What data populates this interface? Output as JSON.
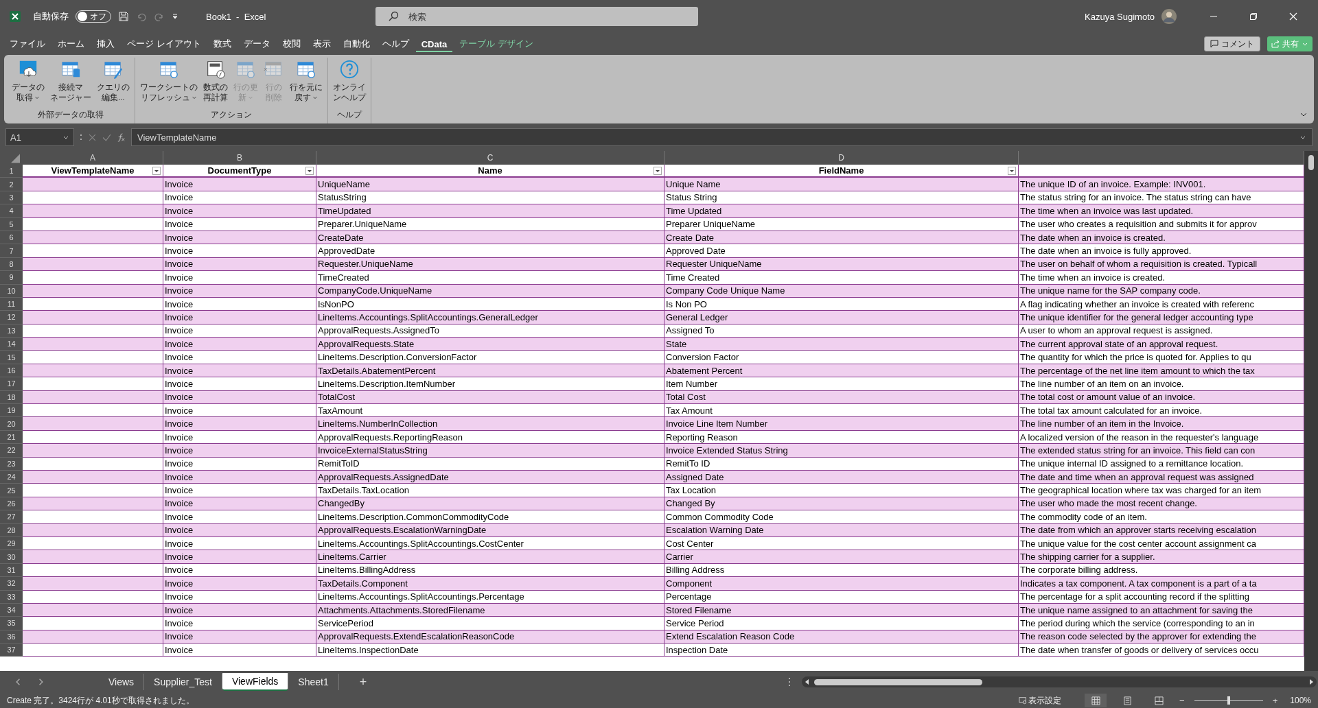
{
  "title_bar": {
    "autosave_label": "自動保存",
    "autosave": {
      "on": false,
      "label": "オフ"
    },
    "quick_access": [
      {
        "kind": "save",
        "disabled": false
      },
      {
        "kind": "undo",
        "disabled": true
      },
      {
        "kind": "redo",
        "disabled": true
      },
      {
        "kind": "customize",
        "disabled": false
      }
    ],
    "title": "Book1  -  Excel",
    "search": {
      "placeholder": "検索"
    },
    "user": "Kazuya Sugimoto"
  },
  "menu_tabs": [
    {
      "label": "ファイル",
      "selected": false,
      "kind": "normal"
    },
    {
      "label": "ホーム",
      "selected": false,
      "kind": "normal"
    },
    {
      "label": "挿入",
      "selected": false,
      "kind": "normal"
    },
    {
      "label": "ページ レイアウト",
      "selected": false,
      "kind": "normal"
    },
    {
      "label": "数式",
      "selected": false,
      "kind": "normal"
    },
    {
      "label": "データ",
      "selected": false,
      "kind": "normal"
    },
    {
      "label": "校閲",
      "selected": false,
      "kind": "normal"
    },
    {
      "label": "表示",
      "selected": false,
      "kind": "normal"
    },
    {
      "label": "自動化",
      "selected": false,
      "kind": "normal"
    },
    {
      "label": "ヘルプ",
      "selected": false,
      "kind": "normal"
    },
    {
      "label": "CData",
      "selected": true,
      "kind": "normal"
    },
    {
      "label": "テーブル デザイン",
      "selected": false,
      "kind": "contextual"
    }
  ],
  "header_buttons": {
    "comment": "コメント",
    "share": "共有"
  },
  "ribbon": [
    {
      "label": "外部データの取得",
      "buttons": [
        {
          "kind": "cloud",
          "lines": [
            "データの",
            "取得"
          ],
          "dropdown": true,
          "disabled": false
        },
        {
          "kind": "database",
          "lines": [
            "接続マ",
            "ネージャー"
          ],
          "dropdown": false,
          "disabled": false
        },
        {
          "kind": "edit",
          "lines": [
            "クエリの",
            "編集..."
          ],
          "dropdown": false,
          "disabled": false
        }
      ]
    },
    {
      "label": "アクション",
      "buttons": [
        {
          "kind": "refresh",
          "lines": [
            "ワークシートの",
            "リフレッシュ"
          ],
          "dropdown": true,
          "disabled": false
        },
        {
          "kind": "formula",
          "lines": [
            "数式の",
            "再計算"
          ],
          "dropdown": false,
          "disabled": false
        },
        {
          "kind": "update",
          "lines": [
            "行の更",
            "新"
          ],
          "dropdown": true,
          "disabled": true
        },
        {
          "kind": "delete",
          "lines": [
            "行の",
            "削除"
          ],
          "dropdown": false,
          "disabled": true
        },
        {
          "kind": "revert",
          "lines": [
            "行を元に",
            "戻す"
          ],
          "dropdown": true,
          "disabled": false
        }
      ]
    },
    {
      "label": "ヘルプ",
      "buttons": [
        {
          "kind": "help",
          "lines": [
            "オンライ",
            "ンヘルプ"
          ],
          "dropdown": false,
          "disabled": false
        }
      ]
    }
  ],
  "formula_bar": {
    "name_box": "A1",
    "value": "ViewTemplateName"
  },
  "column_headers": [
    "A",
    "B",
    "C",
    "D"
  ],
  "header_row": {
    "row": "1",
    "cells": [
      "ViewTemplateName",
      "DocumentType",
      "Name",
      "FieldName"
    ]
  },
  "rows": [
    {
      "row": "2",
      "document_type": "Invoice",
      "name": "UniqueName",
      "field_name": "Unique Name",
      "column_e": "The unique ID of an invoice. Example: INV001."
    },
    {
      "row": "3",
      "document_type": "Invoice",
      "name": "StatusString",
      "field_name": "Status String",
      "column_e": "The status string for an invoice. The status string can have"
    },
    {
      "row": "4",
      "document_type": "Invoice",
      "name": "TimeUpdated",
      "field_name": "Time Updated",
      "column_e": "The time when an invoice was last updated."
    },
    {
      "row": "5",
      "document_type": "Invoice",
      "name": "Preparer.UniqueName",
      "field_name": "Preparer UniqueName",
      "column_e": "The user who creates a requisition and submits it for approv"
    },
    {
      "row": "6",
      "document_type": "Invoice",
      "name": "CreateDate",
      "field_name": "Create Date",
      "column_e": "The date when an invoice is created."
    },
    {
      "row": "7",
      "document_type": "Invoice",
      "name": "ApprovedDate",
      "field_name": "Approved Date",
      "column_e": "The date when an invoice is fully approved."
    },
    {
      "row": "8",
      "document_type": "Invoice",
      "name": "Requester.UniqueName",
      "field_name": "Requester UniqueName",
      "column_e": "The user on behalf of whom a requisition is created. Typicall"
    },
    {
      "row": "9",
      "document_type": "Invoice",
      "name": "TimeCreated",
      "field_name": "Time Created",
      "column_e": "The time when an invoice is created."
    },
    {
      "row": "10",
      "document_type": "Invoice",
      "name": "CompanyCode.UniqueName",
      "field_name": "Company Code Unique Name",
      "column_e": "The unique name for the SAP company code."
    },
    {
      "row": "11",
      "document_type": "Invoice",
      "name": "IsNonPO",
      "field_name": "Is Non PO",
      "column_e": "A flag indicating whether an invoice is created with referenc"
    },
    {
      "row": "12",
      "document_type": "Invoice",
      "name": "LineItems.Accountings.SplitAccountings.GeneralLedger",
      "field_name": "General Ledger",
      "column_e": "The unique identifier for the general ledger accounting type"
    },
    {
      "row": "13",
      "document_type": "Invoice",
      "name": "ApprovalRequests.AssignedTo",
      "field_name": "Assigned To",
      "column_e": "A user to whom an approval request is assigned."
    },
    {
      "row": "14",
      "document_type": "Invoice",
      "name": "ApprovalRequests.State",
      "field_name": "State",
      "column_e": "The current approval state of an approval request."
    },
    {
      "row": "15",
      "document_type": "Invoice",
      "name": "LineItems.Description.ConversionFactor",
      "field_name": "Conversion Factor",
      "column_e": "The quantity for which the price is quoted for. Applies to qu"
    },
    {
      "row": "16",
      "document_type": "Invoice",
      "name": "TaxDetails.AbatementPercent",
      "field_name": "Abatement Percent",
      "column_e": "The percentage of the net line item amount to which the tax"
    },
    {
      "row": "17",
      "document_type": "Invoice",
      "name": "LineItems.Description.ItemNumber",
      "field_name": "Item Number",
      "column_e": "The line number of an item on an invoice."
    },
    {
      "row": "18",
      "document_type": "Invoice",
      "name": "TotalCost",
      "field_name": "Total Cost",
      "column_e": "The total cost or amount value of an invoice."
    },
    {
      "row": "19",
      "document_type": "Invoice",
      "name": "TaxAmount",
      "field_name": "Tax Amount",
      "column_e": "The total tax amount calculated for an invoice."
    },
    {
      "row": "20",
      "document_type": "Invoice",
      "name": "LineItems.NumberInCollection",
      "field_name": "Invoice Line Item Number",
      "column_e": "The line number of an item in the Invoice."
    },
    {
      "row": "21",
      "document_type": "Invoice",
      "name": "ApprovalRequests.ReportingReason",
      "field_name": "Reporting Reason",
      "column_e": "A localized version of the reason in the requester's language"
    },
    {
      "row": "22",
      "document_type": "Invoice",
      "name": "InvoiceExternalStatusString",
      "field_name": "Invoice Extended Status String",
      "column_e": "The extended status string for an invoice. This field can con"
    },
    {
      "row": "23",
      "document_type": "Invoice",
      "name": "RemitToID",
      "field_name": "RemitTo ID",
      "column_e": "The unique internal ID assigned to a remittance location."
    },
    {
      "row": "24",
      "document_type": "Invoice",
      "name": "ApprovalRequests.AssignedDate",
      "field_name": "Assigned Date",
      "column_e": "The date and time when an approval request was assigned"
    },
    {
      "row": "25",
      "document_type": "Invoice",
      "name": "TaxDetails.TaxLocation",
      "field_name": "Tax Location",
      "column_e": "The geographical location where tax was charged for an item"
    },
    {
      "row": "26",
      "document_type": "Invoice",
      "name": "ChangedBy",
      "field_name": "Changed By",
      "column_e": "The user who made the most recent change."
    },
    {
      "row": "27",
      "document_type": "Invoice",
      "name": "LineItems.Description.CommonCommodityCode",
      "field_name": "Common Commodity Code",
      "column_e": "The commodity code of an item."
    },
    {
      "row": "28",
      "document_type": "Invoice",
      "name": "ApprovalRequests.EscalationWarningDate",
      "field_name": "Escalation Warning Date",
      "column_e": "The date from which an approver starts receiving escalation"
    },
    {
      "row": "29",
      "document_type": "Invoice",
      "name": "LineItems.Accountings.SplitAccountings.CostCenter",
      "field_name": "Cost Center",
      "column_e": "The unique value for the cost center account assignment ca"
    },
    {
      "row": "30",
      "document_type": "Invoice",
      "name": "LineItems.Carrier",
      "field_name": "Carrier",
      "column_e": "The shipping carrier for a supplier."
    },
    {
      "row": "31",
      "document_type": "Invoice",
      "name": "LineItems.BillingAddress",
      "field_name": "Billing Address",
      "column_e": "The corporate billing address."
    },
    {
      "row": "32",
      "document_type": "Invoice",
      "name": "TaxDetails.Component",
      "field_name": "Component",
      "column_e": "Indicates a tax component. A tax component is a part of a ta"
    },
    {
      "row": "33",
      "document_type": "Invoice",
      "name": "LineItems.Accountings.SplitAccountings.Percentage",
      "field_name": "Percentage",
      "column_e": "The percentage for a split accounting record if the splitting"
    },
    {
      "row": "34",
      "document_type": "Invoice",
      "name": "Attachments.Attachments.StoredFilename",
      "field_name": "Stored Filename",
      "column_e": "The unique name assigned to an attachment for saving the"
    },
    {
      "row": "35",
      "document_type": "Invoice",
      "name": "ServicePeriod",
      "field_name": "Service Period",
      "column_e": "The period during which the service (corresponding to an in"
    },
    {
      "row": "36",
      "document_type": "Invoice",
      "name": "ApprovalRequests.ExtendEscalationReasonCode",
      "field_name": "Extend Escalation Reason Code",
      "column_e": "The reason code selected by the approver for extending the"
    },
    {
      "row": "37",
      "document_type": "Invoice",
      "name": "LineItems.InspectionDate",
      "field_name": "Inspection Date",
      "column_e": "The date when transfer of goods or delivery of services occu"
    }
  ],
  "sheet_tabs": [
    {
      "label": "Views",
      "selected": false
    },
    {
      "label": "Supplier_Test",
      "selected": false
    },
    {
      "label": "ViewFields",
      "selected": true
    },
    {
      "label": "Sheet1",
      "selected": false
    }
  ],
  "add_sheet": "+",
  "status_bar": {
    "message": "Create 完了。3424行が 4.01秒で取得されました。",
    "display_settings": "表示設定",
    "views": [
      {
        "kind": "normal",
        "selected": true
      },
      {
        "kind": "page_layout",
        "selected": false
      },
      {
        "kind": "page_break",
        "selected": false
      }
    ],
    "zoom": {
      "level": 0.5,
      "minus": "−",
      "plus": "+",
      "reading": "100%"
    }
  }
}
